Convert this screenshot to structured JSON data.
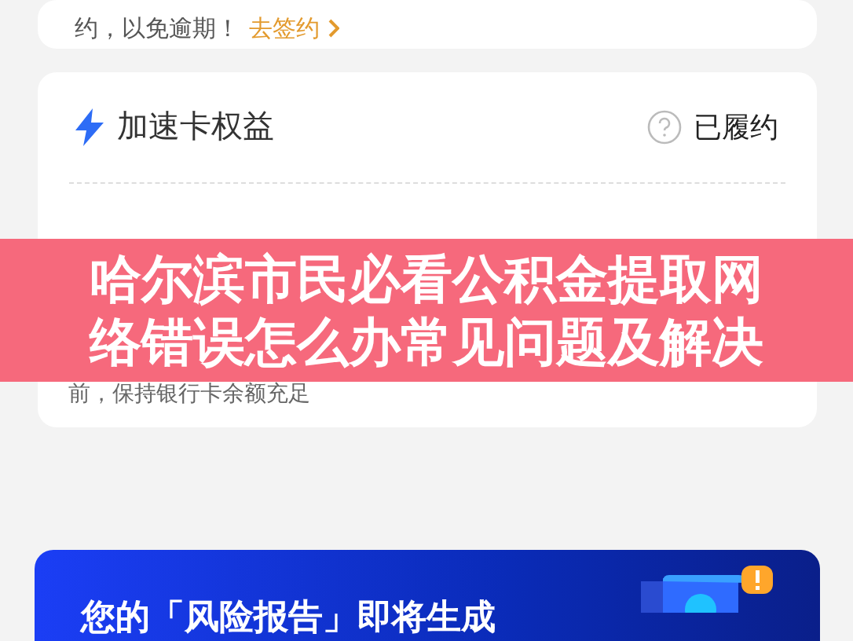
{
  "notice_card": {
    "text": "约，以免逾期！",
    "link": "去签约"
  },
  "benefit_card": {
    "title": "加速卡权益",
    "status": "已履约",
    "note": "前，保持银行卡余额充足"
  },
  "overlay_banner": {
    "lines": [
      "哈尔滨市民必看公积金提取网",
      "络错误怎么办常见问题及解决"
    ]
  },
  "report_banner": {
    "title": "您的「风险报告」即将生成"
  }
}
